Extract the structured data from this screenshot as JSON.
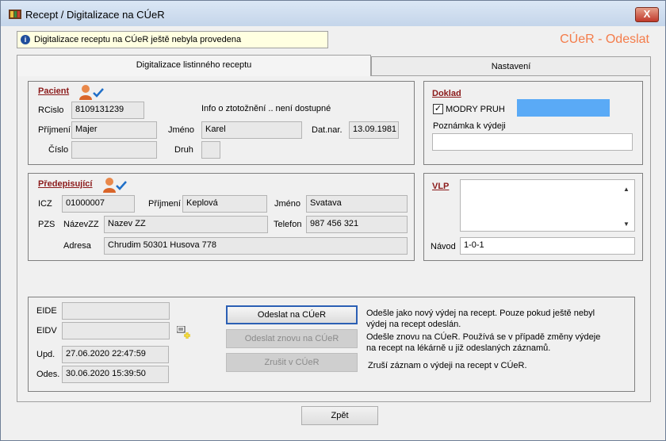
{
  "window": {
    "title": "Recept  / Digitalizace na CÚeR",
    "close_label": "X"
  },
  "info": {
    "message": "Digitalizace receptu na CÚeR ještě nebyla provedena",
    "icon": "info-icon"
  },
  "brand": "CÚeR - Odeslat",
  "tabs": [
    {
      "label": "Digitalizace listinného receptu",
      "active": true
    },
    {
      "label": "Nastavení",
      "active": false
    }
  ],
  "patient": {
    "title": "Pacient",
    "rcislo_label": "RCislo",
    "rcislo": "8109131239",
    "identity_note": "Info o ztotožnění .. není dostupné",
    "prijmeni_label": "Příjmení",
    "prijmeni": "Majer",
    "jmeno_label": "Jméno",
    "jmeno": "Karel",
    "datnar_label": "Dat.nar.",
    "datnar": "13.09.1981",
    "cislo_label": "Číslo",
    "cislo": "",
    "druh_label": "Druh",
    "druh": ""
  },
  "doklad": {
    "title": "Doklad",
    "modry_pruh_label": "MODRY PRUH",
    "modry_pruh_checked": "✓",
    "color_box": "#5aaaf6",
    "poznamka_label": "Poznámka k výdeji",
    "poznamka": ""
  },
  "prescriber": {
    "title": "Předepisující",
    "icz_label": "ICZ",
    "icz": "01000007",
    "prijmeni_label": "Příjmení",
    "prijmeni": "Keplová",
    "jmeno_label": "Jméno",
    "jmeno": "Svatava",
    "pzs_label": "PZS",
    "nazevzz_label": "NázevZZ",
    "nazevzz": "Nazev ZZ",
    "telefon_label": "Telefon",
    "telefon": "987 456 321",
    "adresa_label": "Adresa",
    "adresa": "Chrudim 50301 Husova 778"
  },
  "vlp": {
    "title": "VLP",
    "text": "",
    "navod_label": "Návod",
    "navod": "1-0-1"
  },
  "bottom": {
    "eide_label": "EIDE",
    "eide": "",
    "eidv_label": "EIDV",
    "eidv": "",
    "upd_label": "Upd.",
    "upd": "27.06.2020 22:47:59",
    "odes_label": "Odes.",
    "odes": "30.06.2020 15:39:50",
    "btn_send": "Odeslat na CÚeR",
    "btn_resend": "Odeslat znovu na CÚeR",
    "btn_cancel": "Zrušit v CÚeR",
    "desc_send_1": "Odešle jako nový výdej na recept. Pouze pokud ještě nebyl",
    "desc_send_2": "výdej na recept odeslán.",
    "desc_resend_1": "Odešle znovu na CÚeR. Používá se v případě změny výdeje",
    "desc_resend_2": " na recept na lékárně u již odeslaných záznamů.",
    "desc_cancel": "Zruší záznam o výdeji  na recept v CÚeR."
  },
  "footer": {
    "back_label": "Zpět"
  },
  "colors": {
    "accent": "#f47c4a",
    "group_title": "#8b1a1a",
    "check_blue": "#1f6fc8"
  }
}
